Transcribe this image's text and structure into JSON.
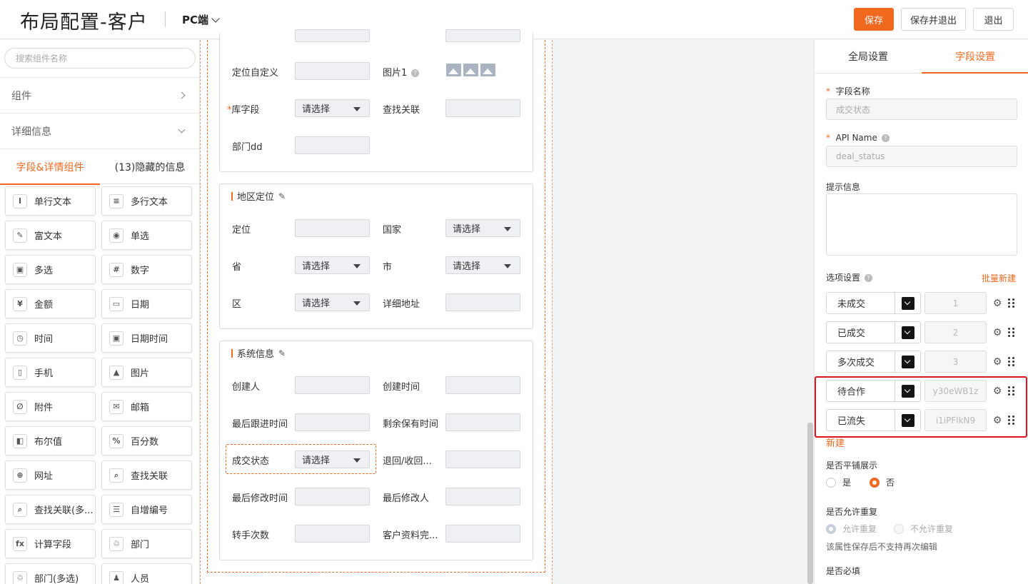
{
  "header": {
    "title": "布局配置-客户",
    "platform": "PC端",
    "save": "保存",
    "save_exit": "保存并退出",
    "exit": "退出"
  },
  "left": {
    "search_placeholder": "搜索组件名称",
    "sections": [
      "组件",
      "详细信息"
    ],
    "tabs": [
      "字段&详情组件",
      "(13)隐藏的信息"
    ],
    "components": [
      {
        "label": "单行文本",
        "icon": "I"
      },
      {
        "label": "多行文本",
        "icon": "≡"
      },
      {
        "label": "富文本",
        "icon": "✎"
      },
      {
        "label": "单选",
        "icon": "◉"
      },
      {
        "label": "多选",
        "icon": "▣"
      },
      {
        "label": "数字",
        "icon": "#"
      },
      {
        "label": "金额",
        "icon": "¥"
      },
      {
        "label": "日期",
        "icon": "▭"
      },
      {
        "label": "时间",
        "icon": "◷"
      },
      {
        "label": "日期时间",
        "icon": "▣"
      },
      {
        "label": "手机",
        "icon": "▯"
      },
      {
        "label": "图片",
        "icon": "▲"
      },
      {
        "label": "附件",
        "icon": "∅"
      },
      {
        "label": "邮箱",
        "icon": "✉"
      },
      {
        "label": "布尔值",
        "icon": "◧"
      },
      {
        "label": "百分数",
        "icon": "%"
      },
      {
        "label": "网址",
        "icon": "⊕"
      },
      {
        "label": "查找关联",
        "icon": "⌕"
      },
      {
        "label": "查找关联(多...",
        "icon": "⌕"
      },
      {
        "label": "自增编号",
        "icon": "☰"
      },
      {
        "label": "计算字段",
        "icon": "fx"
      },
      {
        "label": "部门",
        "icon": "♲"
      },
      {
        "label": "部门(多选)",
        "icon": "♲"
      },
      {
        "label": "人员",
        "icon": "♟"
      }
    ]
  },
  "canvas": {
    "select_text": "请选择",
    "top_fields": {
      "custom_location": "定位自定义",
      "image1": "图片1",
      "lib_field": "库字段",
      "lookup": "查找关联",
      "dept": "部门dd"
    },
    "region": {
      "title": "地区定位",
      "location": "定位",
      "country": "国家",
      "province": "省",
      "city": "市",
      "district": "区",
      "address": "详细地址"
    },
    "system": {
      "title": "系统信息",
      "creator": "创建人",
      "created_at": "创建时间",
      "last_follow": "最后跟进时间",
      "remaining": "剩余保有时间",
      "deal_status": "成交状态",
      "return": "退回/收回...",
      "last_modified": "最后修改时间",
      "last_modifier": "最后修改人",
      "transfers": "转手次数",
      "completeness": "客户资料完..."
    }
  },
  "right": {
    "tabs": [
      "全局设置",
      "字段设置"
    ],
    "field_name_label": "字段名称",
    "field_name_value": "成交状态",
    "api_name_label": "API Name",
    "api_name_value": "deal_status",
    "hint_label": "提示信息",
    "options_label": "选项设置",
    "batch_new": "批量新建",
    "options": [
      {
        "name": "未成交",
        "value": "1",
        "color": "#141414"
      },
      {
        "name": "已成交",
        "value": "2",
        "color": "#141414"
      },
      {
        "name": "多次成交",
        "value": "3",
        "color": "#141414"
      },
      {
        "name": "待合作",
        "value": "y30eWB1z",
        "color": "#141414"
      },
      {
        "name": "已流失",
        "value": "i1iPFlkN9",
        "color": "#141414"
      }
    ],
    "new_link": "新建",
    "tile_label": "是否平铺展示",
    "yes": "是",
    "no": "否",
    "dup_label": "是否允许重复",
    "allow_dup": "允许重复",
    "disallow_dup": "不允许重复",
    "dup_hint": "该属性保存后不支持再次编辑",
    "required_label": "是否必填"
  },
  "colors": {
    "accent": "#f0691f",
    "highlight": "#e0141e"
  }
}
